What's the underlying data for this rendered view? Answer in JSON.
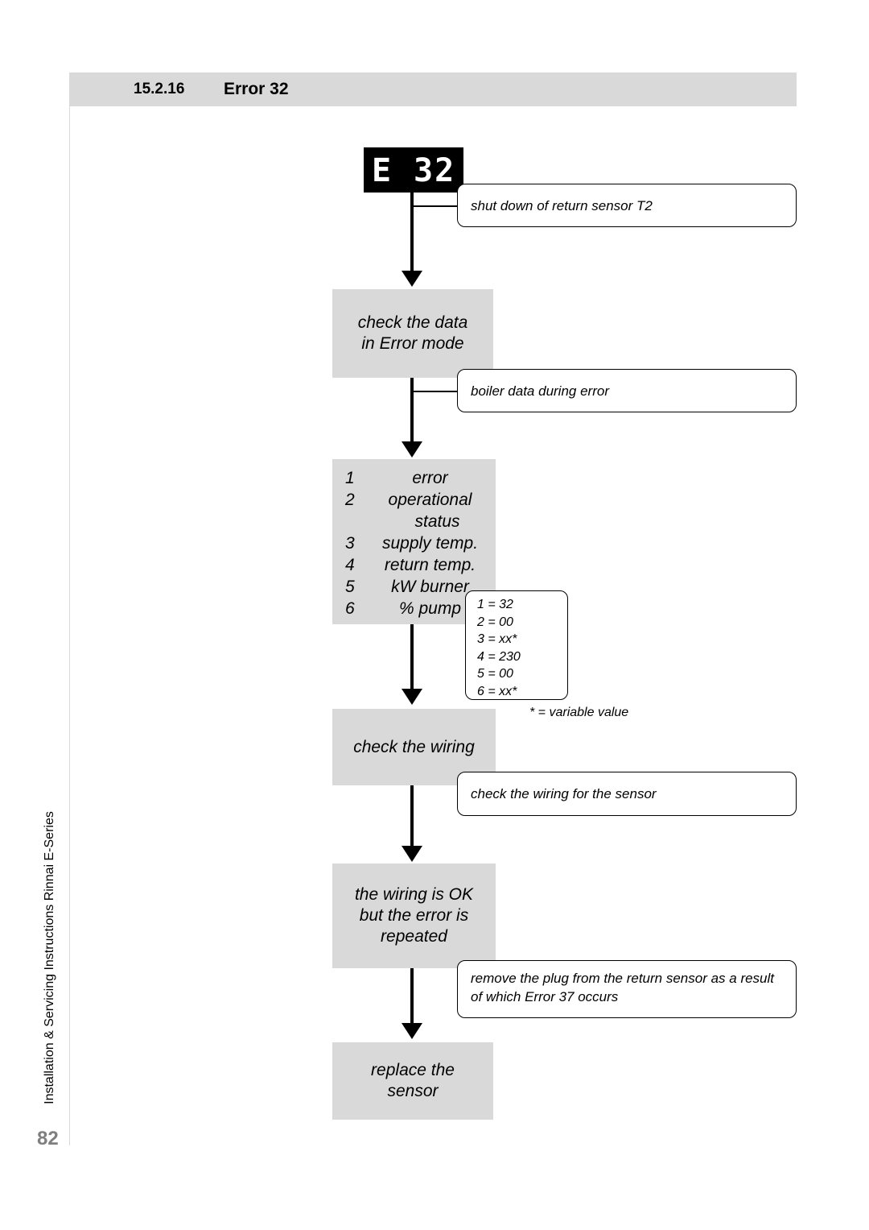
{
  "header": {
    "number": "15.2.16",
    "title": "Error 32"
  },
  "side": {
    "vertical_text": "Installation & Servicing Instructions Rinnai E-Series",
    "page_number": "82"
  },
  "display": {
    "left": "E",
    "right": "32"
  },
  "flow": {
    "check_data_line1": "check the data",
    "check_data_line2": "in Error mode",
    "list_items": [
      {
        "num": "1",
        "text": "error",
        "indent": ""
      },
      {
        "num": "2",
        "text": "operational",
        "indent": "status"
      },
      {
        "num": "3",
        "text": "supply temp.",
        "indent": ""
      },
      {
        "num": "4",
        "text": "return temp.",
        "indent": ""
      },
      {
        "num": "5",
        "text": "kW burner",
        "indent": ""
      },
      {
        "num": "6",
        "text": "% pump",
        "indent": ""
      }
    ],
    "check_wiring": "check the wiring",
    "ok_line1": "the wiring is OK",
    "ok_line2": "but the error is",
    "ok_line3": "repeated",
    "replace_line1": "replace the",
    "replace_line2": "sensor"
  },
  "callouts": {
    "shutdown": "shut down of return sensor T2",
    "boiler": "boiler data during error",
    "wiring": "check the wiring for the sensor",
    "remove": "remove the plug from the return sensor as a result of which Error 37 occurs"
  },
  "values": {
    "rows": [
      "1 = 32",
      "2 = 00",
      "3 = xx*",
      "4 = 230",
      "5 = 00",
      "6 = xx*"
    ],
    "note": "* = variable value"
  }
}
